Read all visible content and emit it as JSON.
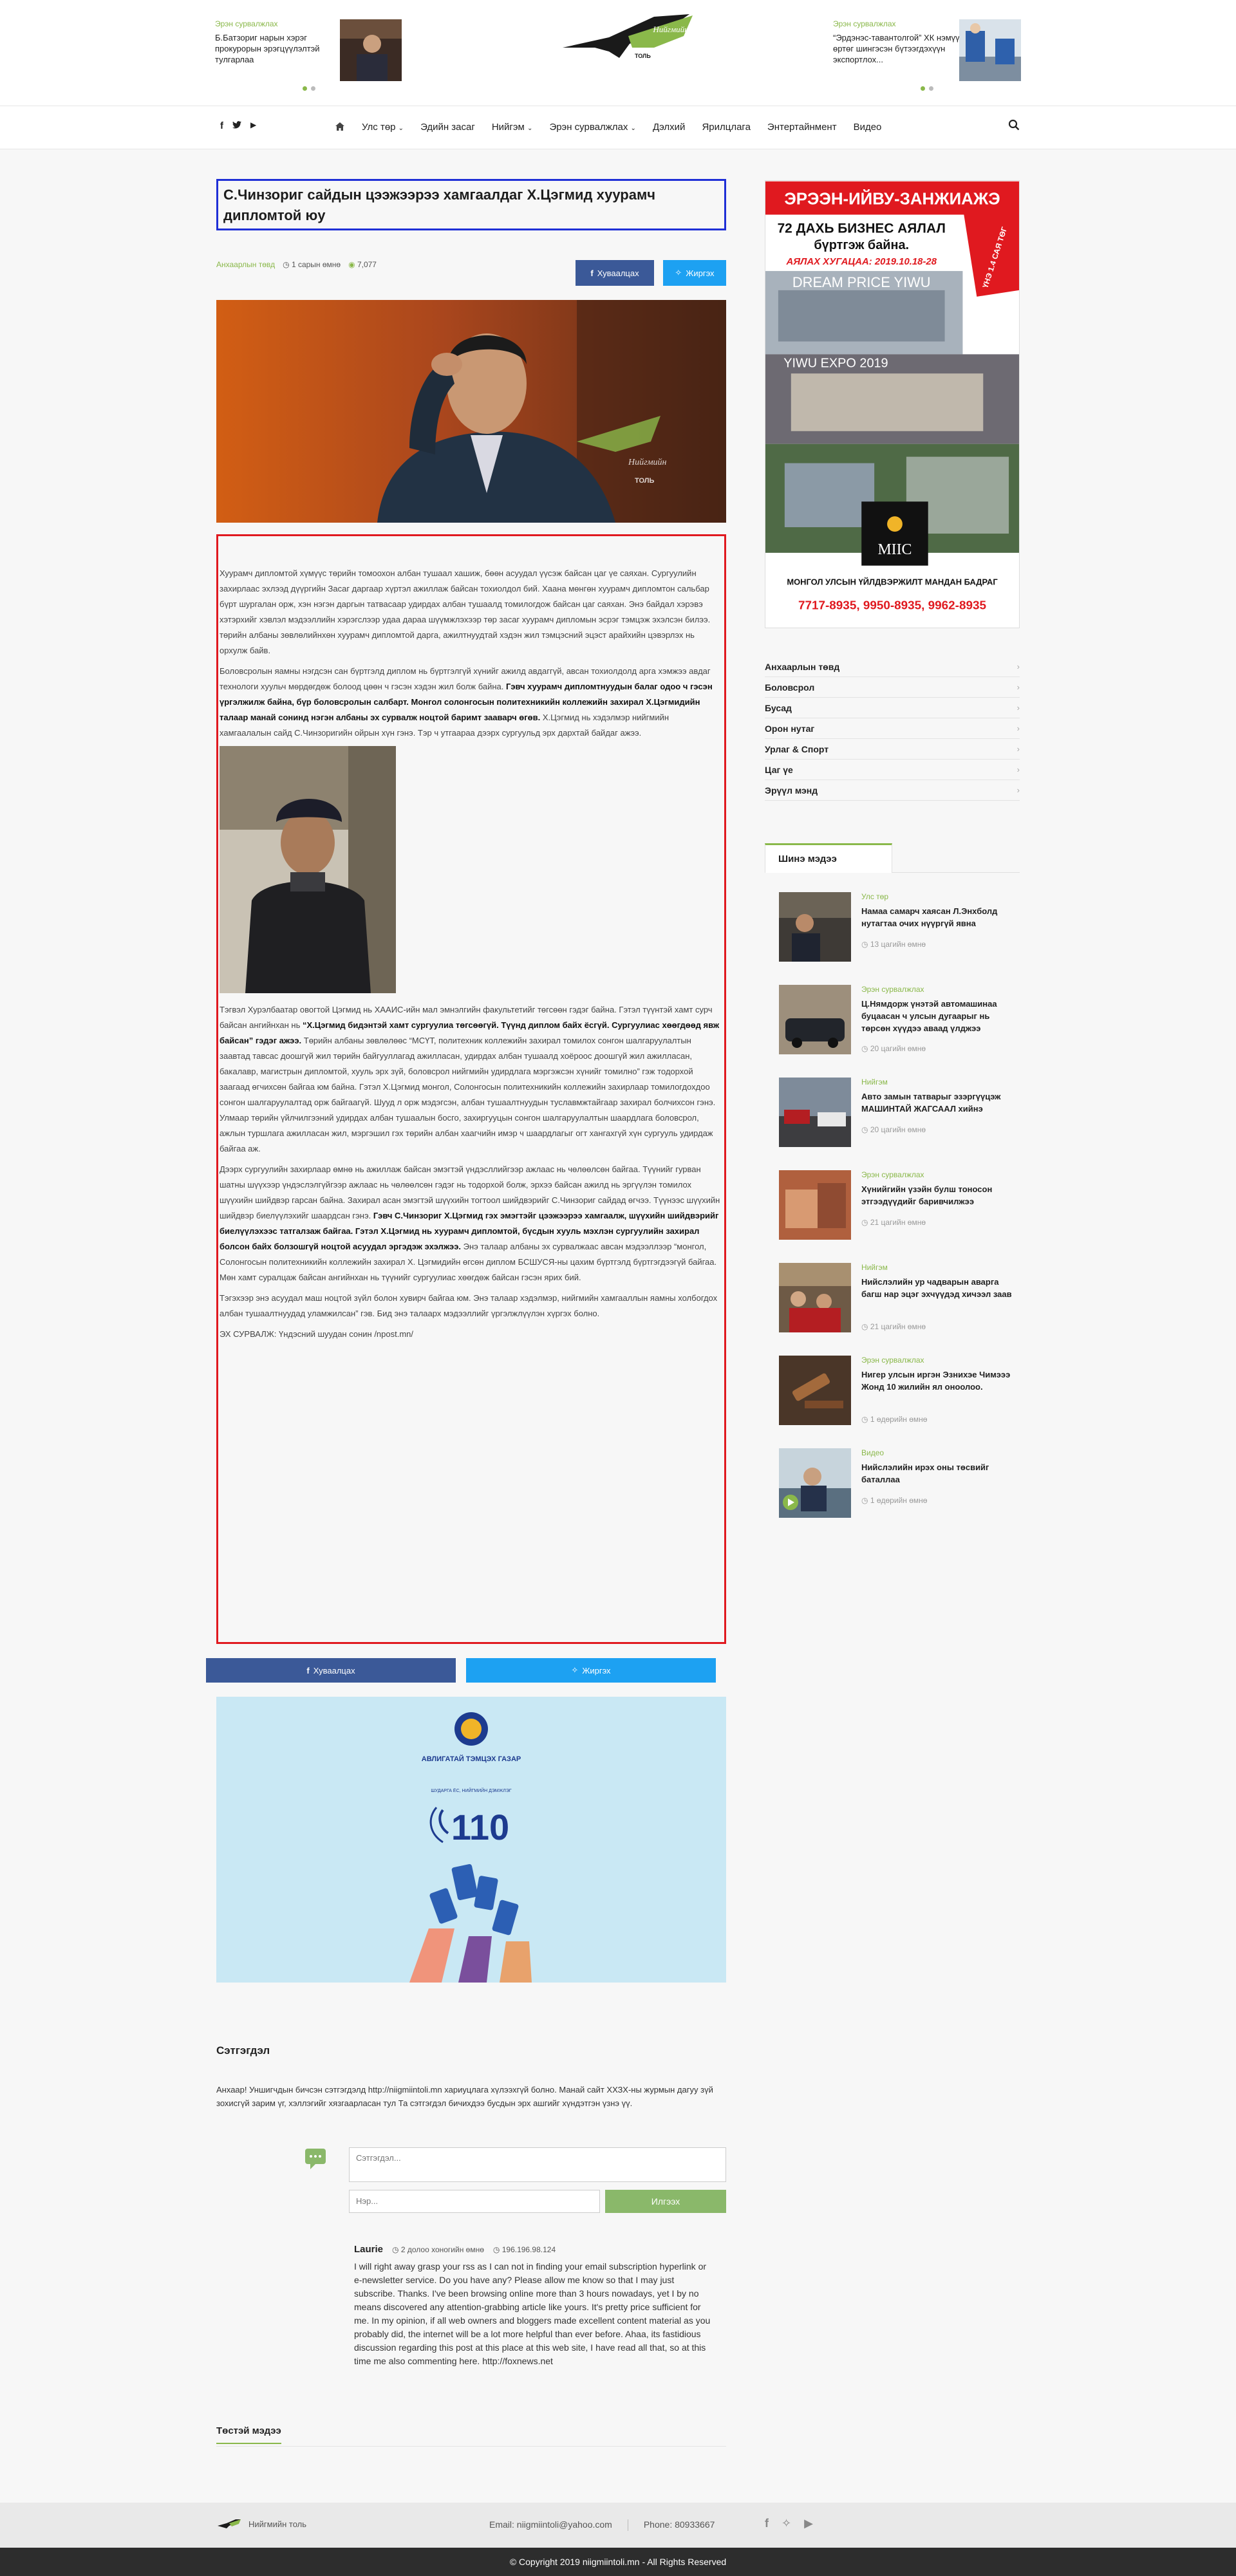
{
  "ticker": {
    "left": {
      "category": "Эрэн сурвалжлах",
      "text": "Б.Батзориг нарын хэрэг прокурорын эрэгцүүлэлтэй тулгарлаа"
    },
    "right": {
      "category": "Эрэн сурвалжлах",
      "text": "“Эрдэнэс-тавантолгой” ХК нэмүү өртөг шингэсэн бүтээгдэхүүн экспортлох..."
    }
  },
  "logo": {
    "text": "Нийгмийн",
    "sub": "ТОЛЬ"
  },
  "nav": {
    "social": [
      "f",
      "t",
      "▶"
    ],
    "items": [
      "Улс төр",
      "Эдийн засаг",
      "Нийгэм",
      "Эрэн сурвалжлах",
      "Дэлхий",
      "Ярилцлага",
      "Энтертайнмент",
      "Видео"
    ],
    "dropdown_flags": [
      true,
      false,
      true,
      true,
      false,
      false,
      false,
      false
    ]
  },
  "article": {
    "title": "С.Чинзориг сайдын цээжээрээ хамгаалдаг Х.Цэгмид хуурамч дипломтой юу",
    "category": "Анхаарлын төвд",
    "date": "1 сарын өмнө",
    "views": "7,077",
    "share_fb": "Хуваалцах",
    "share_tw": "Жиргэх",
    "hero_watermark": "Нийгмийн",
    "hero_watermark_sub": "ТОЛЬ",
    "p1": "Хуурамч дипломтой хүмүүс төрийн томоохон албан тушаал хашиж, бөөн асуудал үүсэж байсан цаг үе саяхан. Сургуулийн захирлаас эхлээд дүүргийн Засаг даргаар хүртэл ажиллаж байсан тохиолдол бий. Хаана мөнгөн хуурамч дипломтон сальбар бүрт шургалан орж, хэн нэгэн даргын татвасаар удирдах албан тушаалд томилогдож байсан цаг саяхан. Энэ байдал хэрэвэ хэтэрхийг хэвлэл мэдээллийн хэрэгслээр удаа дараа шүүмжлэхээр төр засаг хуурамч дипломын эсрэг тэмцэж эхэлсэн билээ. төрийн албаны зөвлөлийнхөн хуурамч дипломтой дарга, ажилтнуудтай хэдэн жил тэмцэсний эцэст арайхийн цэвэрлэх нь орхулж байв.",
    "p2a": "Боловсролын яамны нэгдсэн сан бүртгэлд диплом нь бүртгэлгүй хүнийг ажилд авдаггүй, авсан тохиолдолд арга хэмжээ авдаг технологи хуульч мөрдөгдөж болоод цөөн ч гэсэн хэдэн жил болж байна. ",
    "p2b": "Гэвч хуурамч дипломтнуудын балаг одоо ч гэсэн үргэлжилж байна, бүр боловсролын салбарт. Монгол солонгосын политехникийн коллежийн захирал Х.Цэгмидийн талаар манай сонинд нэгэн албаны эх сурвалж ноцтой баримт зааварч өгөв.",
    "p2c": " Х.Цэгмид нь хэдэлмэр нийгмийн хамгаалалын сайд С.Чинзоригийн ойрын хүн гэнэ. Тэр ч утгаараа дээрх сургуульд эрх дархтай байдаг ажээ.",
    "p3a": "Тэгвэл Хурэлбаатар овогтой Цэгмид нь ХААИС-ийн мал эмнэлгийн факультетийг төгсөөн гэдэг байна. Гэтэл түүнтэй хамт сурч байсан ангийнхан нь ",
    "p3b": "“Х.Цэгмид бидэнтэй хамт сургуулиа төгсөөгүй. Түүнд диплом байх ёсгүй. Сургуулиас хөөгдөөд явж байсан” гэдэг ажээ.",
    "p3c": " Төрийн албаны зөвлөлөөс “МСҮТ, политехник коллежийн захирал томилох сонгон шалгаруулалтын заавтад тавсас доошгүй жил төрийн байгууллагад ажилласан, удирдах албан тушаалд хоёроос доошгүй жил ажилласан, бакалавр, магистрын дипломтой, хууль эрх зүй, боловсрол нийгмийн удирдлага мэргэжсэн хүнийг томилно” гэж тодорхой заагаад өгчихсөн байгаа юм байна. Гэтэл Х.Цэгмид монгол, Солонгосын политехникийн коллежийн захирлаар томилогдохдоо сонгон шалгаруулалтад орж байгаагүй. Шууд л орж мэдэгсэн, албан тушаалтнуудын туславмжтайгаар захирал болчихсон гэнэ. Улмаар төрийн үйлчилгээний удирдах албан тушаалын босго, захиргууцын сонгон шалгаруулалтын шаардлага боловсрол, ажлын туршлага ажилласан жил, мэргэшил гэх төрийн албан хаагчийн имэр ч шаардлагыг огт хангахгүй хүн сургууль удирдаж байгаа аж.",
    "p4a": "Дээрх сургуулийн захирлаар өмнө нь ажиллаж байсан эмэгтэй үндэсллийгээр ажлаас нь чөлөөлсөн байгаа. Түүнийг гурван шатны шүүхээр үндэслэлгүйгээр ажлаас нь чөлөөлсөн гэдэг нь тодорхой болж, эрхээ байсан ажилд нь эргүүлэн томилох шүүхийн шийдвэр гарсан байна. Захирал асан эмэгтэй шүүхийн тогтоол шийдвэрийг С.Чинзориг сайдад өгчээ. Түүнээс шүүхийн шийдвэр биелүүлэхийг шаардсан гэнэ. ",
    "p4b": "Гэвч С.Чинзориг Х.Цэгмид гэх эмэгтэйг цээжээрээ хамгаалж, шүүхийн шийдвэрийг биелүүлэхээс татгалзаж байгаа. Гэтэл Х.Цэгмид нь хуурамч дипломтой, бүсдын хууль мэхлэн сургуулийн захирал болсон байх болзошгүй ноцтой асуудал эргэдэж эхэлжээ.",
    "p4c": " Энэ талаар албаны эх сурвалжаас авсан мэдээллээр “монгол, Солонгосын политехникийн коллежийн захирал Х. Цэгмидийн өгсөн диплом БСШУСЯ-ны цахим бүртгэлд бүртгэгдээгүй байгаа. Мөн хамт суралцаж байсан ангийнхан нь түүнийг сургуулиас хөөгдөж байсан гэсэн ярих бий.",
    "p5": "Тэгэхээр энэ асуудал маш ноцтой зүйл болон хувирч байгаа юм. Энэ талаар хэдэлмэр, нийгмийн хамгааллын яамны холбогдох албан тушаалтнуудад уламжилсан” гэв. Бид энэ талаарх мэдээллийг үргэлжлүүлэн хүргэх болно.",
    "source": "ЭХ СУРВАЛЖ: Үндэсний шуудан сонин /npost.mn/"
  },
  "bottom_share": {
    "fb": "Хуваалцах",
    "tw": "Жиргэх"
  },
  "banner110": {
    "org": "АВЛИГАТАЙ ТЭМЦЭХ ГАЗАР",
    "tagline": "ШУДАРГА ЁС, НИЙГМИЙН ДЭМЖЛЭГ",
    "number": "110"
  },
  "comments": {
    "title": "Сэтгэгдэл",
    "note": "Анхаар! Уншигчдын бичсэн сэтгэгдэлд http://niigmiintoli.mn хариуцлага хүлээхгүй болно. Манай сайт ХХЗХ-ны журмын дагуу зүй зохисгүй зарим үг, хэллэгийг хязгаарласан тул Та сэтгэгдэл бичихдээ бусдын эрх ашгийг хүндэтгэн үзнэ үү.",
    "comment_placeholder": "Сэтгэгдэл...",
    "name_placeholder": "Нэр...",
    "send": "Илгээх",
    "items": [
      {
        "author": "Laurie",
        "time": "2 долоо хоногийн өмнө",
        "ip": "196.196.98.124",
        "text": "I will right away grasp your rss as I can not in finding your email subscription hyperlink or e-newsletter service. Do you have any? Please allow me know so that I may just subscribe. Thanks. I've been browsing online more than 3 hours nowadays, yet I by no means discovered any attention-grabbing article like yours. It's pretty price sufficient for me. In my opinion, if all web owners and bloggers made excellent content material as you probably did, the internet will be a lot more helpful than ever before. Ahaa, its fastidious discussion regarding this post at this place at this web site, I have read all that, so at this time me also commenting here. http://foxnews.net"
      }
    ]
  },
  "similar": {
    "title": "Төстэй мэдээ"
  },
  "ad_right": {
    "headline": "ЭРЭЭН-ИЙВУ-ЗАНЖИАЖЭ",
    "line1": "72 ДАХЬ БИЗНЕС АЯЛАЛ",
    "line2": "бүртгэж байна.",
    "line3": "АЯЛАХ ХУГАЦАА: 2019.10.18-28",
    "ribbon": "ҮНЭ 1.4 САЯ ТӨГ",
    "dream": "DREAM PRICE   YIWU",
    "expo": "YIWU EXPO 2019",
    "miic": "MIIC",
    "company": "МОНГОЛ УЛСЫН ҮЙЛДВЭРЖИЛТ МАНДАН БАДРАГ",
    "phones": "7717-8935, 9950-8935, 9962-8935"
  },
  "categories": [
    "Анхаарлын төвд",
    "Боловсрол",
    "Бусад",
    "Орон нутаг",
    "Урлаг & Спорт",
    "Цаг үе",
    "Эрүүл мэнд"
  ],
  "news": {
    "tab": "Шинэ мэдээ",
    "items": [
      {
        "category": "Улс төр",
        "title": "Намаа самарч хаясан Л.Энхболд нутагтаа очих нүүргүй явна",
        "time": "13 цагийн өмнө"
      },
      {
        "category": "Эрэн сурвалжлах",
        "title": "Ц.Нямдорж үнэтэй автомашинаа буцаасан ч улсын дугаарыг нь төрсөн хүүдээ аваад үлджээ",
        "time": "20 цагийн өмнө"
      },
      {
        "category": "Нийгэм",
        "title": "Авто замын татварыг эзэргүүцэж МАШИНТАЙ ЖАГСААЛ хийнэ",
        "time": "20 цагийн өмнө"
      },
      {
        "category": "Эрэн сурвалжлах",
        "title": "Хүнийгийн үзэйн булш тоносон этгээдүүдийг баривчилжээ",
        "time": "21 цагийн өмнө"
      },
      {
        "category": "Нийгэм",
        "title": "Нийслэлийн ур чадварын аварга багш нар эцэг эхчүүдэд хичээл заав",
        "time": "21 цагийн өмнө"
      },
      {
        "category": "Эрэн сурвалжлах",
        "title": "Нигер улсын иргэн Эзнихэе Чимэээ Жонд 10 жилийн ял оноолоо.",
        "time": "1 өдөрийн өмнө"
      },
      {
        "category": "Видео",
        "title": "Нийслэлийн ирэх оны төсвийг баталлаа",
        "time": "1 өдөрийн өмнө"
      }
    ]
  },
  "footer": {
    "logo_text": "Нийгмийн толь",
    "email": "Email: niigmiintoli@yahoo.com",
    "phone": "Phone: 80933667",
    "copyright": "© Copyright 2019 niigmiintoli.mn - All Rights Reserved"
  },
  "colors": {
    "accent": "#8ab84a",
    "facebook": "#3b5998",
    "twitter": "#1da1f2",
    "title_border": "#1f2fd6",
    "body_border": "#e0191f"
  }
}
